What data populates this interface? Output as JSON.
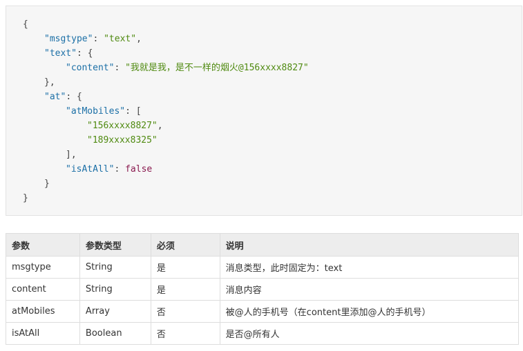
{
  "code_lines": [
    {
      "indent": 0,
      "tokens": [
        {
          "t": "{",
          "c": "punct"
        }
      ]
    },
    {
      "indent": 1,
      "tokens": [
        {
          "t": "\"msgtype\"",
          "c": "key"
        },
        {
          "t": ": ",
          "c": "punct"
        },
        {
          "t": "\"text\"",
          "c": "str"
        },
        {
          "t": ",",
          "c": "punct"
        }
      ]
    },
    {
      "indent": 1,
      "tokens": [
        {
          "t": "\"text\"",
          "c": "key"
        },
        {
          "t": ": {",
          "c": "punct"
        }
      ]
    },
    {
      "indent": 2,
      "tokens": [
        {
          "t": "\"content\"",
          "c": "key"
        },
        {
          "t": ": ",
          "c": "punct"
        },
        {
          "t": "\"我就是我，是不一样的烟火@156xxxx8827\"",
          "c": "str"
        }
      ]
    },
    {
      "indent": 1,
      "tokens": [
        {
          "t": "},",
          "c": "punct"
        }
      ]
    },
    {
      "indent": 1,
      "tokens": [
        {
          "t": "\"at\"",
          "c": "key"
        },
        {
          "t": ": {",
          "c": "punct"
        }
      ]
    },
    {
      "indent": 2,
      "tokens": [
        {
          "t": "\"atMobiles\"",
          "c": "key"
        },
        {
          "t": ": [",
          "c": "punct"
        }
      ]
    },
    {
      "indent": 3,
      "tokens": [
        {
          "t": "\"156xxxx8827\"",
          "c": "str"
        },
        {
          "t": ",",
          "c": "punct"
        }
      ]
    },
    {
      "indent": 3,
      "tokens": [
        {
          "t": "\"189xxxx8325\"",
          "c": "str"
        }
      ]
    },
    {
      "indent": 2,
      "tokens": [
        {
          "t": "],",
          "c": "punct"
        }
      ]
    },
    {
      "indent": 2,
      "tokens": [
        {
          "t": "\"isAtAll\"",
          "c": "key"
        },
        {
          "t": ": ",
          "c": "punct"
        },
        {
          "t": "false",
          "c": "lit"
        }
      ]
    },
    {
      "indent": 1,
      "tokens": [
        {
          "t": "}",
          "c": "punct"
        }
      ]
    },
    {
      "indent": 0,
      "tokens": [
        {
          "t": "}",
          "c": "punct"
        }
      ]
    }
  ],
  "table": {
    "headers": [
      "参数",
      "参数类型",
      "必须",
      "说明"
    ],
    "rows": [
      [
        "msgtype",
        "String",
        "是",
        "消息类型，此时固定为：text"
      ],
      [
        "content",
        "String",
        "是",
        "消息内容"
      ],
      [
        "atMobiles",
        "Array",
        "否",
        "被@人的手机号（在content里添加@人的手机号）"
      ],
      [
        "isAtAll",
        "Boolean",
        "否",
        "是否@所有人"
      ]
    ]
  }
}
